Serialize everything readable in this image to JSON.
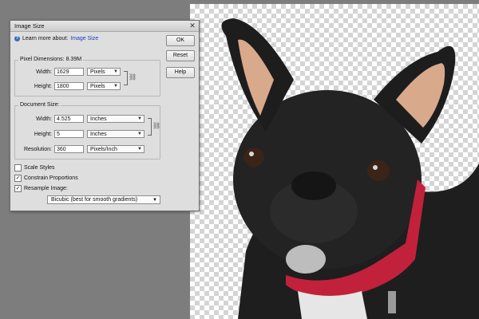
{
  "dialog": {
    "title": "Image Size",
    "learn_prefix": "Learn more about:",
    "learn_link": "Image Size",
    "buttons": {
      "ok": "OK",
      "reset": "Reset",
      "help": "Help"
    },
    "pixel_dimensions": {
      "legend": "Pixel Dimensions:",
      "size": "8.39M",
      "width_label": "Width:",
      "width_value": "1629",
      "width_unit": "Pixels",
      "height_label": "Height:",
      "height_value": "1800",
      "height_unit": "Pixels"
    },
    "document_size": {
      "legend": "Document Size:",
      "width_label": "Width:",
      "width_value": "4.525",
      "width_unit": "Inches",
      "height_label": "Height:",
      "height_value": "5",
      "height_unit": "Inches",
      "resolution_label": "Resolution:",
      "resolution_value": "360",
      "resolution_unit": "Pixels/Inch"
    },
    "options": {
      "scale_styles": {
        "label": "Scale Styles",
        "checked": false
      },
      "constrain_proportions": {
        "label": "Constrain Proportions",
        "checked": true
      },
      "resample_image": {
        "label": "Resample Image:",
        "checked": true
      }
    },
    "resample_method": "Bicubic (best for smooth gradients)"
  },
  "icons": {
    "help": "help-circle-icon",
    "close": "close-icon",
    "chain": "link-chain-icon",
    "dropdown": "chevron-down-icon"
  },
  "colors": {
    "workspace": "#7d7d7d",
    "dialog_bg": "#dedede",
    "link": "#1a3fbf",
    "checker": "#d4d4d4"
  }
}
